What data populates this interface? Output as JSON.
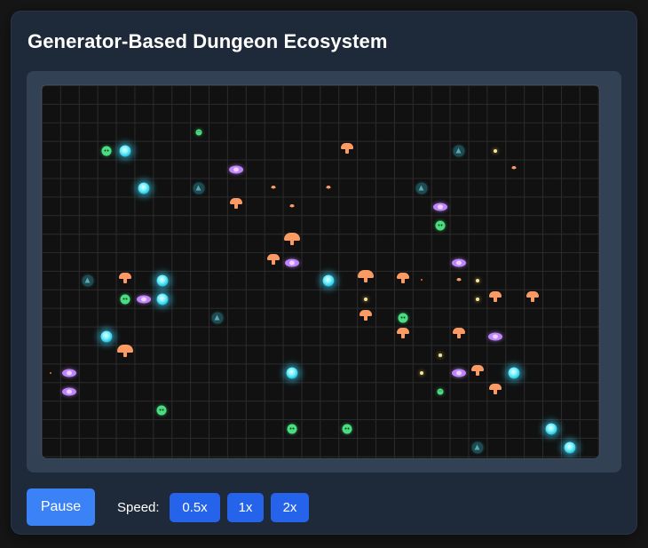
{
  "app": {
    "title": "Generator-Based Dungeon Ecosystem"
  },
  "controls": {
    "pause_label": "Pause",
    "speed_label": "Speed:",
    "speed_options": [
      "0.5x",
      "1x",
      "2x"
    ]
  },
  "colors": {
    "panel": "#1e2a3a",
    "viewport": "#334155",
    "grid_background": "#111111",
    "button_primary": "#3b82f6",
    "button_speed": "#2563eb",
    "orb": "#67e8f9",
    "slime": "#4ade80",
    "mushroom": "#fb9a63",
    "bat": "#c084fc",
    "spirit": "#1e4a52",
    "spore": "#fde68a"
  },
  "legend_icons": [
    "orb-icon",
    "slime-icon",
    "mushroom-icon",
    "bat-icon",
    "spirit-icon",
    "spore-icon"
  ]
}
